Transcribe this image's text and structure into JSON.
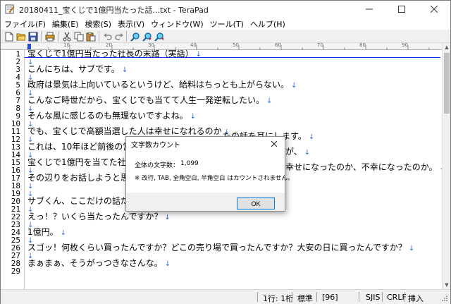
{
  "window": {
    "title": "20180411_宝くじで1億円当たった話...txt - TeraPad",
    "controls": [
      "minimize-icon",
      "maximize-icon",
      "close-icon"
    ]
  },
  "menu": [
    "ファイル(F)",
    "編集(E)",
    "検索(S)",
    "表示(V)",
    "ウィンドウ(W)",
    "ツール(T)",
    "ヘルプ(H)"
  ],
  "toolbar": {
    "icons": [
      "new-file-icon",
      "open-folder-icon",
      "save-icon",
      "print-icon",
      "cut-icon",
      "copy-icon",
      "paste-icon",
      "undo-icon",
      "redo-icon",
      "search-icon",
      "search-next-icon",
      "search-previous-icon"
    ]
  },
  "ruler": {
    "labels": [
      "10",
      "20",
      "30",
      "40",
      "50",
      "60",
      "70",
      "80",
      "90"
    ]
  },
  "editor": {
    "eol_mark": "↓",
    "line_numbers": [
      "1",
      "2",
      "3",
      "4",
      "5",
      "6",
      "7",
      "8",
      "9",
      "10",
      "11",
      "12",
      "13",
      "14",
      "15",
      "16",
      "17",
      "18",
      "19",
      "20",
      "21",
      "22",
      "23",
      "24",
      "25",
      "26",
      "27",
      "28",
      "29"
    ],
    "lines": [
      "宝くじで1億円当たった社長の末路（実話）",
      "",
      "こんにちは、サブです。",
      "",
      "政府は景気は上向いているというけど、給料はちっとも上がらない。",
      "",
      "こんなご時世だから、宝くじでも当てて人生一発逆転したい。",
      "",
      "そんな風に感じるのも無理ないですよね。",
      "",
      "でも、宝くじで高額当選した人は幸せになれるのか",
      "",
      "これは、10年ほど前後の営",
      "",
      "宝くじで1億円を当てた社長",
      "",
      "その辺りをお話しようと思",
      "",
      "",
      "サブくん、ここだけの話だ",
      "",
      "えっ！？いくら当たったんですか？",
      "",
      "1億円。",
      "",
      "スゴッ！何枚くらい買ったんですか？どこの売り場で買ったんですか？大安の日に買ったんですか？",
      "",
      "まぁまぁ、そうがっつきなさんな。",
      ""
    ],
    "right_fragments": {
      "line11": "たの話を耳にします。",
      "line13": "が、",
      "line15": "幸せになったのか、不幸になったのか。"
    }
  },
  "statusbar": {
    "position": "1行: 1桁",
    "mode": "標準",
    "code_value": "[96]",
    "encoding": "SJIS",
    "line_ending": "CRLF",
    "insert_mode": "挿入"
  },
  "dialog": {
    "title": "文字数カウント",
    "count_label": "全体の文字数：",
    "count_value": "1,099",
    "note": "※ 改行, TAB, 全角空白, 半角空白 はカウントされません。",
    "ok_label": "OK"
  }
}
